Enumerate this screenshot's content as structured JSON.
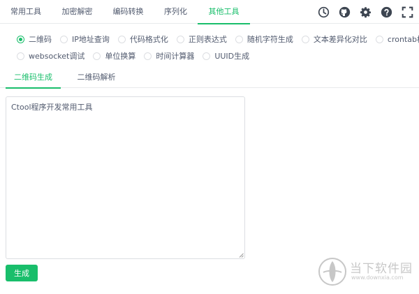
{
  "nav": {
    "tabs": [
      {
        "label": "常用工具"
      },
      {
        "label": "加密解密"
      },
      {
        "label": "编码转换"
      },
      {
        "label": "序列化"
      },
      {
        "label": "其他工具"
      }
    ],
    "active_tab": "其他工具"
  },
  "toolbar_icons": [
    "clock-icon",
    "github-icon",
    "gear-icon",
    "help-icon",
    "fullscreen-icon"
  ],
  "tools": {
    "row1": [
      "二维码",
      "IP地址查询",
      "代码格式化",
      "正则表达式",
      "随机字符生成",
      "文本差异化对比",
      "crontab校验"
    ],
    "row2": [
      "websocket调试",
      "单位换算",
      "时间计算器",
      "UUID生成"
    ],
    "selected": "二维码"
  },
  "subtabs": [
    {
      "label": "二维码生成"
    },
    {
      "label": "二维码解析"
    }
  ],
  "active_subtab": "二维码生成",
  "input": {
    "value": "Ctool程序开发常用工具"
  },
  "generate_button": {
    "label": "生成"
  },
  "watermark": {
    "title": "当下软件园",
    "url": "www.downxia.com"
  },
  "colors": {
    "accent": "#19be6b",
    "text": "#515a6e",
    "border": "#dcdee2",
    "icon": "#3d4551"
  }
}
